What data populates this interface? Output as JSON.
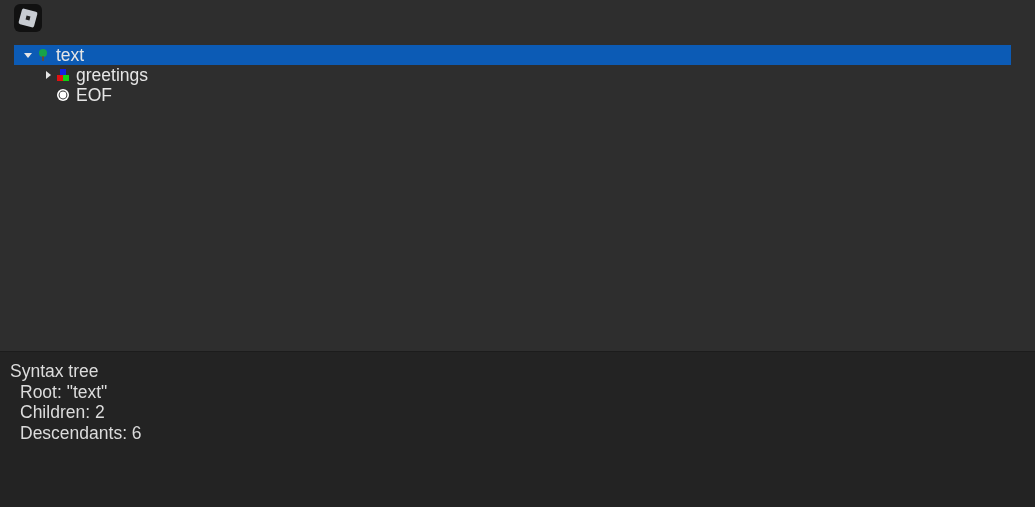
{
  "tree": [
    {
      "label": "text",
      "kind": "tree",
      "expanded": true,
      "selected": true,
      "children": [
        {
          "label": "greetings",
          "kind": "group",
          "expanded": false,
          "selected": false
        },
        {
          "label": "EOF",
          "kind": "token",
          "selected": false
        }
      ]
    }
  ],
  "details": {
    "title": "Syntax tree",
    "lines": [
      "Root: \"text\"",
      "Children: 2",
      "Descendants: 6"
    ]
  }
}
